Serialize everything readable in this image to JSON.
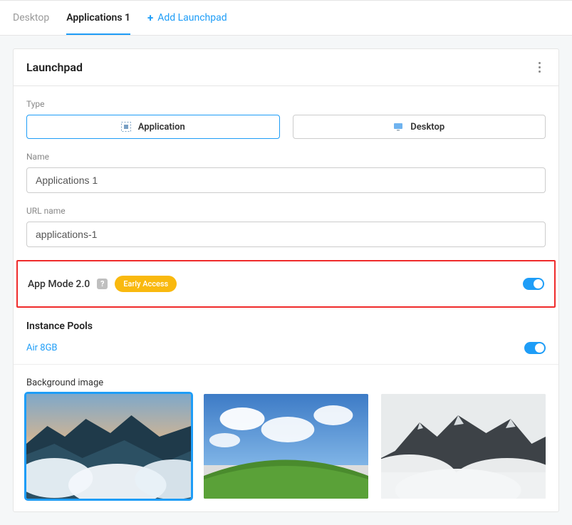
{
  "tabs": {
    "desktop": "Desktop",
    "applications": "Applications 1",
    "add": "Add Launchpad"
  },
  "card": {
    "title": "Launchpad"
  },
  "form": {
    "type_label": "Type",
    "type_application": "Application",
    "type_desktop": "Desktop",
    "name_label": "Name",
    "name_value": "Applications 1",
    "url_label": "URL name",
    "url_value": "applications-1"
  },
  "appmode": {
    "title": "App Mode 2.0",
    "help": "?",
    "badge": "Early Access"
  },
  "pools": {
    "title": "Instance Pools",
    "item": "Air 8GB"
  },
  "bg": {
    "label": "Background image"
  }
}
